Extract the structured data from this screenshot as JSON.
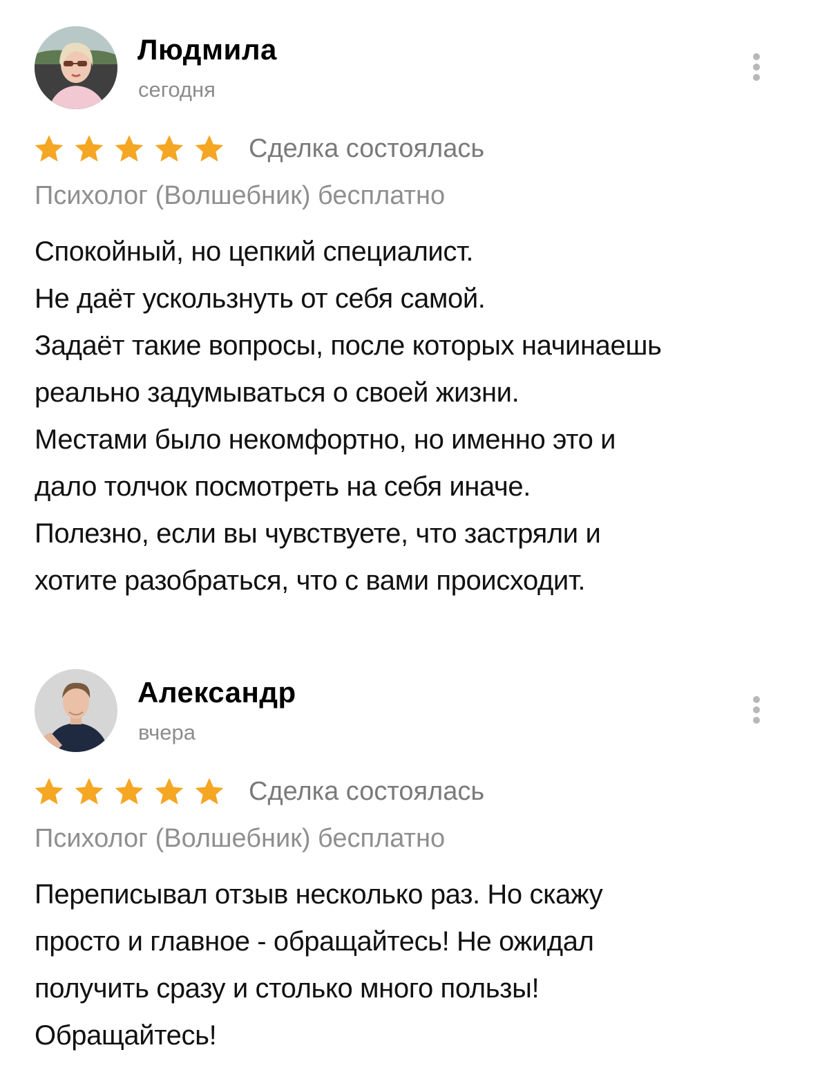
{
  "colors": {
    "star": "#f5a623",
    "secondary_text": "#8c8c8c",
    "menu_dots": "#b8b8b8"
  },
  "reviews": [
    {
      "author": "Людмила",
      "date": "сегодня",
      "rating": 5,
      "rating_max": 5,
      "status": "Сделка состоялась",
      "service": "Психолог (Волшебник) бесплатно",
      "avatar_icon": "user-photo-woman",
      "menu_icon": "more-vertical-icon",
      "text_lines": [
        "Спокойный, но цепкий специалист.",
        "Не даёт ускользнуть от себя самой.",
        "Задаёт такие вопросы, после которых начинаешь",
        "реально задумываться о своей жизни.",
        "Местами было некомфортно, но именно это и",
        "дало толчок посмотреть на себя иначе.",
        "Полезно, если вы чувствуете, что застряли и",
        "хотите разобраться, что с вами происходит."
      ]
    },
    {
      "author": "Александр",
      "date": "вчера",
      "rating": 5,
      "rating_max": 5,
      "status": "Сделка состоялась",
      "service": "Психолог (Волшебник) бесплатно",
      "avatar_icon": "user-photo-man",
      "menu_icon": "more-vertical-icon",
      "text_lines": [
        "Переписывал отзыв несколько раз. Но скажу",
        "просто и главное - обращайтесь! Не ожидал",
        "получить сразу и столько много пользы!",
        "Обращайтесь!"
      ]
    }
  ]
}
